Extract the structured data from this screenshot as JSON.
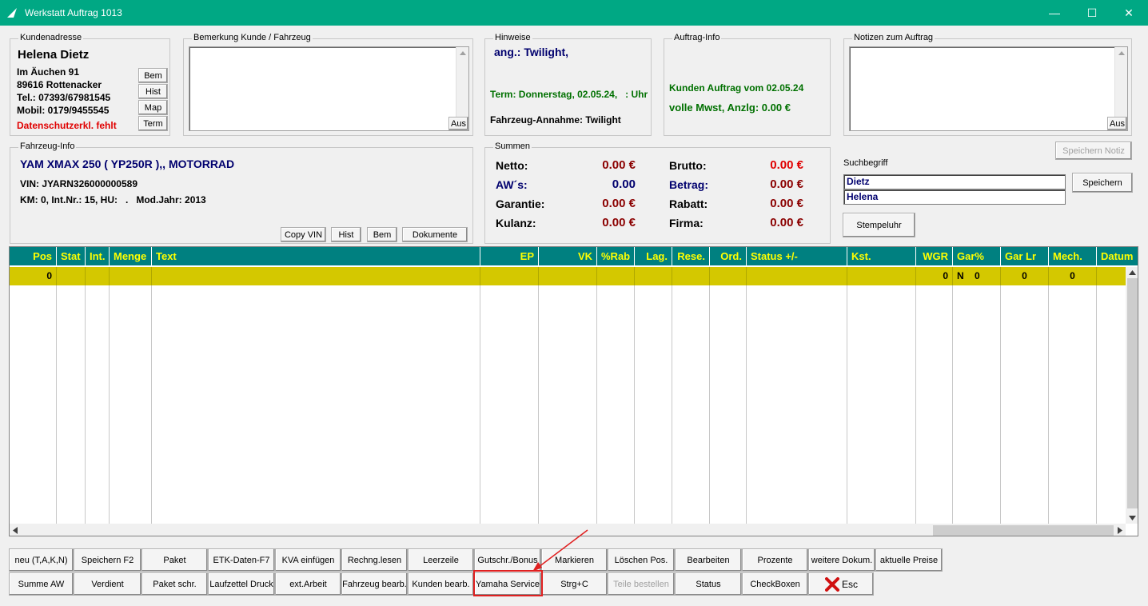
{
  "window": {
    "title": "Werkstatt Auftrag 1013",
    "minimize": "—",
    "maximize": "☐",
    "close": "✕"
  },
  "kundenadresse": {
    "legend": "Kundenadresse",
    "name": "Helena Dietz",
    "street": "Im Äuchen 91",
    "city": "89616 Rottenacker",
    "tel": "Tel.: 07393/67981545",
    "mobil": "Mobil: 0179/9455545",
    "warning": "Datenschutzerkl. fehlt",
    "buttons": [
      "Bem",
      "Hist",
      "Map",
      "Term"
    ]
  },
  "bemerkung": {
    "legend": "Bemerkung Kunde / Fahrzeug",
    "aus": "Aus"
  },
  "hinweise": {
    "legend": "Hinweise",
    "ang": "ang.: Twilight,",
    "term": "Term: Donnerstag, 02.05.24,   : Uhr",
    "annahme": "Fahrzeug-Annahme: Twilight"
  },
  "auftraginfo": {
    "legend": "Auftrag-Info",
    "line1": "Kunden Auftrag vom 02.05.24",
    "line2": "volle Mwst, Anzlg: 0.00 €"
  },
  "notizen": {
    "legend": "Notizen zum Auftrag",
    "aus": "Aus"
  },
  "fahrzeug": {
    "legend": "Fahrzeug-Info",
    "model": "YAM XMAX 250 ( YP250R ),, MOTORRAD",
    "vin": "VIN: JYARN326000000589",
    "km": "KM: 0, Int.Nr.: 15, HU:   .   Mod.Jahr: 2013",
    "buttons": [
      "Copy VIN",
      "Hist",
      "Bem",
      "Dokumente"
    ]
  },
  "summen": {
    "legend": "Summen",
    "netto_label": "Netto:",
    "netto": "0.00 €",
    "aw_label": "AW´s:",
    "aw": "0.00",
    "garantie_label": "Garantie:",
    "garantie": "0.00 €",
    "kulanz_label": "Kulanz:",
    "kulanz": "0.00 €",
    "brutto_label": "Brutto:",
    "brutto": "0.00 €",
    "betrag_label": "Betrag:",
    "betrag": "0.00 €",
    "rabatt_label": "Rabatt:",
    "rabatt": "0.00 €",
    "firma_label": "Firma:",
    "firma": "0.00 €"
  },
  "search": {
    "speichern_notiz": "Speichern Notiz",
    "label": "Suchbegriff",
    "value1": "Dietz",
    "value2": "Helena",
    "speichern": "Speichern",
    "stempeluhr": "Stempeluhr"
  },
  "grid": {
    "headers": [
      "Pos",
      "Stat",
      "Int.",
      "Menge",
      "Text",
      "EP",
      "VK",
      "%Rab",
      "Lag.",
      "Rese.",
      "Ord.",
      "Status +/-",
      "Kst.",
      "WGR",
      "Gar%",
      "Gar Lr",
      "Mech.",
      "Datum"
    ],
    "row": [
      "0",
      "",
      "",
      "",
      "",
      "",
      "",
      "",
      "",
      "",
      "",
      "",
      "",
      "0",
      "N    0",
      "0",
      "0",
      ". ."
    ]
  },
  "buttons_row1": [
    "neu (T,A,K,N)",
    "Speichern F2",
    "Paket",
    "ETK-Daten-F7",
    "KVA einfügen",
    "Rechng.lesen",
    "Leerzeile",
    "Gutschr./Bonus",
    "Markieren",
    "Löschen Pos.",
    "Bearbeiten",
    "Prozente",
    "weitere Dokum.",
    "aktuelle Preise"
  ],
  "buttons_row2": [
    "Summe AW",
    "Verdient",
    "Paket schr.",
    "Laufzettel Druck",
    "ext.Arbeit",
    "Fahrzeug bearb.",
    "Kunden bearb.",
    "Yamaha Service",
    "Strg+C",
    "Teile bestellen",
    "Status",
    "CheckBoxen",
    "Esc"
  ],
  "colors": {
    "titlebar": "#00a884",
    "grid_header": "#008080",
    "grid_header_text": "#ffff00",
    "row_highlight": "#d4c800",
    "annotation": "#e02020"
  }
}
